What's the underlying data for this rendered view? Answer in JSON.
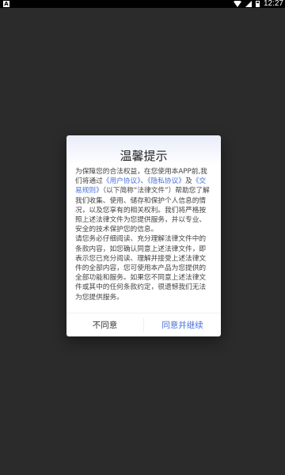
{
  "status_bar": {
    "time": "12:27",
    "left_badge": "A",
    "icons": [
      "wifi-icon",
      "signal-icon",
      "battery-icon"
    ]
  },
  "dialog": {
    "title": "温馨提示",
    "body": {
      "p1_a": "为保障您的合法权益，在您使用本APP前,我们将通过",
      "link_user": "《用户协议》",
      "p1_b": "、",
      "link_privacy": "《隐私协议》",
      "p1_c": "及",
      "link_trade": "《交易规则》",
      "p1_d": "（以下简称“法律文件”）帮助您了解我们收集、使用、储存和保护个人信息的情况，以及您享有的相关权利。我们将严格按照上述法律文件为您提供服务，并以专业、安全的技术保护您的信息。",
      "p2": "请您务必仔细阅读、充分理解法律文件中的条款内容，如您确认同意上述法律文件，即表示您已充分阅读、理解并接受上述法律文件的全部内容，您可使用本产品为您提供的全部功能和服务。如果您不同意上述法律文件或其中的任何条款约定，很遗憾我们无法为您提供服务。"
    },
    "buttons": {
      "disagree": "不同意",
      "agree": "同意并继续"
    }
  },
  "colors": {
    "accent": "#4a6fdc",
    "background": "#2b2b2b"
  }
}
